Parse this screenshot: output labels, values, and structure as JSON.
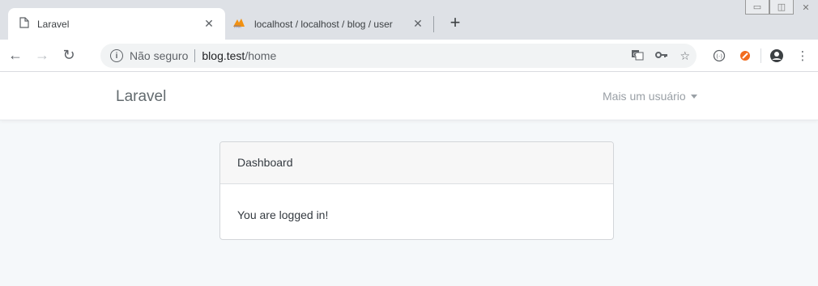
{
  "tabs": [
    {
      "title": "Laravel",
      "icon": "page-icon",
      "active": true
    },
    {
      "title": "localhost / localhost / blog / user",
      "icon": "phpmyadmin-logo-icon",
      "active": false
    }
  ],
  "window_controls": [
    "minimize-icon",
    "maximize-icon",
    "close-icon"
  ],
  "address_bar": {
    "security_label": "Não seguro",
    "host": "blog.test",
    "path": "/home"
  },
  "app": {
    "brand": "Laravel",
    "user_menu": "Mais um usuário",
    "card": {
      "header": "Dashboard",
      "body": "You are logged in!"
    }
  },
  "colors": {
    "tabstrip": "#dee1e6",
    "page_bg": "#f5f8fa",
    "card_header_bg": "#f7f7f7"
  }
}
